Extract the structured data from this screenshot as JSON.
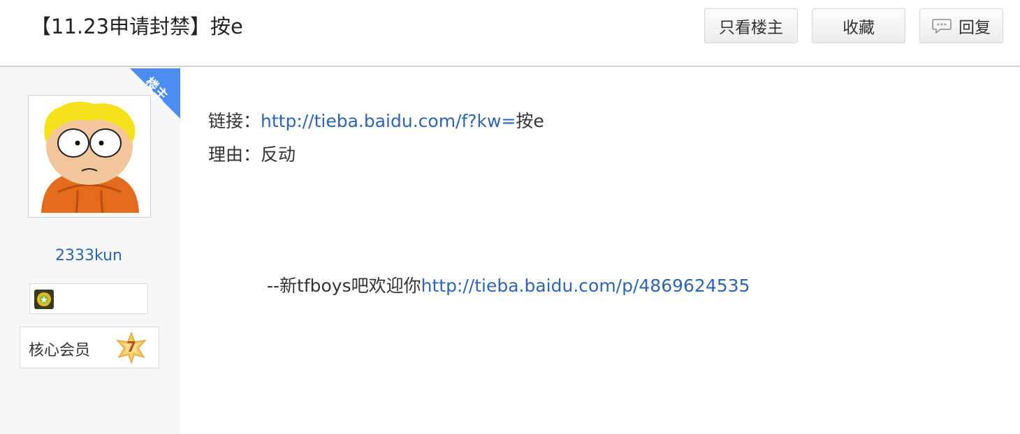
{
  "header": {
    "title": "【11.23申请封禁】按e",
    "buttons": {
      "only_host": "只看楼主",
      "favorite": "收藏",
      "reply": "回复"
    },
    "icons": {
      "reply": "speech-bubble-icon"
    }
  },
  "sidebar": {
    "corner_label": "楼主",
    "username": "2333kun",
    "member": {
      "label": "核心会员",
      "level": "7"
    },
    "icons": {
      "badge": "sunflower-badge-icon",
      "level": "star-level-icon"
    }
  },
  "post": {
    "link_label": "链接：",
    "link_url": "http://tieba.baidu.com/f?kw=",
    "link_suffix": "按e",
    "reason_label": "理由：",
    "reason": "反动",
    "signature_prefix": "--新tfboys吧欢迎你",
    "signature_url": "http://tieba.baidu.com/p/4869624535"
  },
  "colors": {
    "link": "#2d64b3",
    "corner": "#4a8cf0",
    "sidebar_bg": "#f7f8fa"
  }
}
